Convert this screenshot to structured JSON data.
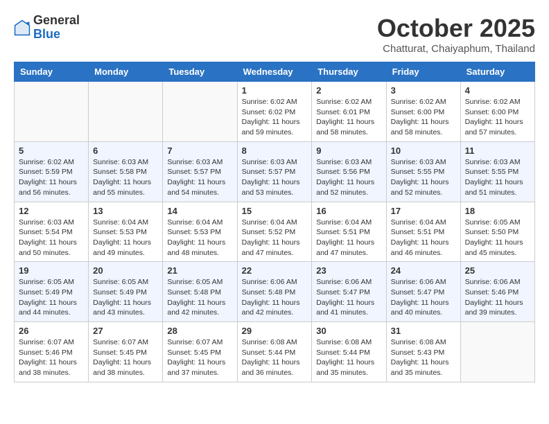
{
  "header": {
    "logo": {
      "general": "General",
      "blue": "Blue"
    },
    "title": "October 2025",
    "subtitle": "Chatturat, Chaiyaphum, Thailand"
  },
  "weekdays": [
    "Sunday",
    "Monday",
    "Tuesday",
    "Wednesday",
    "Thursday",
    "Friday",
    "Saturday"
  ],
  "weeks": [
    [
      {
        "day": "",
        "sunrise": "",
        "sunset": "",
        "daylight": ""
      },
      {
        "day": "",
        "sunrise": "",
        "sunset": "",
        "daylight": ""
      },
      {
        "day": "",
        "sunrise": "",
        "sunset": "",
        "daylight": ""
      },
      {
        "day": "1",
        "sunrise": "Sunrise: 6:02 AM",
        "sunset": "Sunset: 6:02 PM",
        "daylight": "Daylight: 11 hours and 59 minutes."
      },
      {
        "day": "2",
        "sunrise": "Sunrise: 6:02 AM",
        "sunset": "Sunset: 6:01 PM",
        "daylight": "Daylight: 11 hours and 58 minutes."
      },
      {
        "day": "3",
        "sunrise": "Sunrise: 6:02 AM",
        "sunset": "Sunset: 6:00 PM",
        "daylight": "Daylight: 11 hours and 58 minutes."
      },
      {
        "day": "4",
        "sunrise": "Sunrise: 6:02 AM",
        "sunset": "Sunset: 6:00 PM",
        "daylight": "Daylight: 11 hours and 57 minutes."
      }
    ],
    [
      {
        "day": "5",
        "sunrise": "Sunrise: 6:02 AM",
        "sunset": "Sunset: 5:59 PM",
        "daylight": "Daylight: 11 hours and 56 minutes."
      },
      {
        "day": "6",
        "sunrise": "Sunrise: 6:03 AM",
        "sunset": "Sunset: 5:58 PM",
        "daylight": "Daylight: 11 hours and 55 minutes."
      },
      {
        "day": "7",
        "sunrise": "Sunrise: 6:03 AM",
        "sunset": "Sunset: 5:57 PM",
        "daylight": "Daylight: 11 hours and 54 minutes."
      },
      {
        "day": "8",
        "sunrise": "Sunrise: 6:03 AM",
        "sunset": "Sunset: 5:57 PM",
        "daylight": "Daylight: 11 hours and 53 minutes."
      },
      {
        "day": "9",
        "sunrise": "Sunrise: 6:03 AM",
        "sunset": "Sunset: 5:56 PM",
        "daylight": "Daylight: 11 hours and 52 minutes."
      },
      {
        "day": "10",
        "sunrise": "Sunrise: 6:03 AM",
        "sunset": "Sunset: 5:55 PM",
        "daylight": "Daylight: 11 hours and 52 minutes."
      },
      {
        "day": "11",
        "sunrise": "Sunrise: 6:03 AM",
        "sunset": "Sunset: 5:55 PM",
        "daylight": "Daylight: 11 hours and 51 minutes."
      }
    ],
    [
      {
        "day": "12",
        "sunrise": "Sunrise: 6:03 AM",
        "sunset": "Sunset: 5:54 PM",
        "daylight": "Daylight: 11 hours and 50 minutes."
      },
      {
        "day": "13",
        "sunrise": "Sunrise: 6:04 AM",
        "sunset": "Sunset: 5:53 PM",
        "daylight": "Daylight: 11 hours and 49 minutes."
      },
      {
        "day": "14",
        "sunrise": "Sunrise: 6:04 AM",
        "sunset": "Sunset: 5:53 PM",
        "daylight": "Daylight: 11 hours and 48 minutes."
      },
      {
        "day": "15",
        "sunrise": "Sunrise: 6:04 AM",
        "sunset": "Sunset: 5:52 PM",
        "daylight": "Daylight: 11 hours and 47 minutes."
      },
      {
        "day": "16",
        "sunrise": "Sunrise: 6:04 AM",
        "sunset": "Sunset: 5:51 PM",
        "daylight": "Daylight: 11 hours and 47 minutes."
      },
      {
        "day": "17",
        "sunrise": "Sunrise: 6:04 AM",
        "sunset": "Sunset: 5:51 PM",
        "daylight": "Daylight: 11 hours and 46 minutes."
      },
      {
        "day": "18",
        "sunrise": "Sunrise: 6:05 AM",
        "sunset": "Sunset: 5:50 PM",
        "daylight": "Daylight: 11 hours and 45 minutes."
      }
    ],
    [
      {
        "day": "19",
        "sunrise": "Sunrise: 6:05 AM",
        "sunset": "Sunset: 5:49 PM",
        "daylight": "Daylight: 11 hours and 44 minutes."
      },
      {
        "day": "20",
        "sunrise": "Sunrise: 6:05 AM",
        "sunset": "Sunset: 5:49 PM",
        "daylight": "Daylight: 11 hours and 43 minutes."
      },
      {
        "day": "21",
        "sunrise": "Sunrise: 6:05 AM",
        "sunset": "Sunset: 5:48 PM",
        "daylight": "Daylight: 11 hours and 42 minutes."
      },
      {
        "day": "22",
        "sunrise": "Sunrise: 6:06 AM",
        "sunset": "Sunset: 5:48 PM",
        "daylight": "Daylight: 11 hours and 42 minutes."
      },
      {
        "day": "23",
        "sunrise": "Sunrise: 6:06 AM",
        "sunset": "Sunset: 5:47 PM",
        "daylight": "Daylight: 11 hours and 41 minutes."
      },
      {
        "day": "24",
        "sunrise": "Sunrise: 6:06 AM",
        "sunset": "Sunset: 5:47 PM",
        "daylight": "Daylight: 11 hours and 40 minutes."
      },
      {
        "day": "25",
        "sunrise": "Sunrise: 6:06 AM",
        "sunset": "Sunset: 5:46 PM",
        "daylight": "Daylight: 11 hours and 39 minutes."
      }
    ],
    [
      {
        "day": "26",
        "sunrise": "Sunrise: 6:07 AM",
        "sunset": "Sunset: 5:46 PM",
        "daylight": "Daylight: 11 hours and 38 minutes."
      },
      {
        "day": "27",
        "sunrise": "Sunrise: 6:07 AM",
        "sunset": "Sunset: 5:45 PM",
        "daylight": "Daylight: 11 hours and 38 minutes."
      },
      {
        "day": "28",
        "sunrise": "Sunrise: 6:07 AM",
        "sunset": "Sunset: 5:45 PM",
        "daylight": "Daylight: 11 hours and 37 minutes."
      },
      {
        "day": "29",
        "sunrise": "Sunrise: 6:08 AM",
        "sunset": "Sunset: 5:44 PM",
        "daylight": "Daylight: 11 hours and 36 minutes."
      },
      {
        "day": "30",
        "sunrise": "Sunrise: 6:08 AM",
        "sunset": "Sunset: 5:44 PM",
        "daylight": "Daylight: 11 hours and 35 minutes."
      },
      {
        "day": "31",
        "sunrise": "Sunrise: 6:08 AM",
        "sunset": "Sunset: 5:43 PM",
        "daylight": "Daylight: 11 hours and 35 minutes."
      },
      {
        "day": "",
        "sunrise": "",
        "sunset": "",
        "daylight": ""
      }
    ]
  ]
}
